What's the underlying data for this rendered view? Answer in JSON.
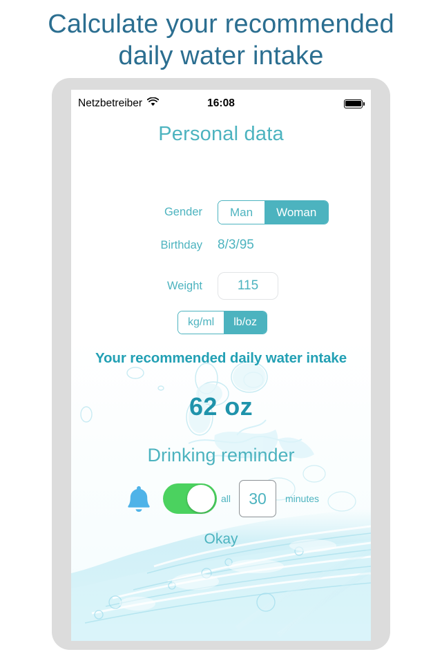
{
  "promo": {
    "line1": "Calculate your recommended",
    "line2": "daily water intake"
  },
  "status_bar": {
    "carrier": "Netzbetreiber",
    "wifi_icon": "wifi-icon",
    "time": "16:08",
    "battery_icon": "battery-full-icon"
  },
  "screen": {
    "title": "Personal data",
    "form": {
      "gender": {
        "label": "Gender",
        "options": [
          "Man",
          "Woman"
        ],
        "selected": "Woman"
      },
      "birthday": {
        "label": "Birthday",
        "value": "8/3/95"
      },
      "weight": {
        "label": "Weight",
        "value": "115"
      },
      "units": {
        "options": [
          "kg/ml",
          "lb/oz"
        ],
        "selected": "lb/oz"
      }
    },
    "result": {
      "heading": "Your recommended daily water intake",
      "value": "62 oz"
    },
    "reminder": {
      "title": "Drinking reminder",
      "bell_icon": "bell-icon",
      "toggle_state": "on",
      "prefix_label": "all",
      "interval": "30",
      "unit_label": "minutes"
    },
    "confirm_label": "Okay"
  },
  "colors": {
    "teal": "#4cb3bf",
    "teal_dark": "#1f93ab",
    "headline": "#2b6e90",
    "toggle_on": "#4bd25f",
    "bell": "#4fb3e8",
    "bezel": "#dcdcdc"
  }
}
